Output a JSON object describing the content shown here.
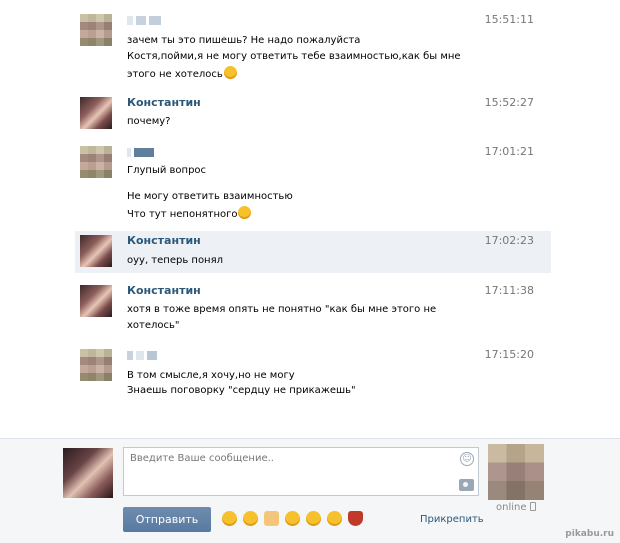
{
  "messages": [
    {
      "sender": "",
      "time": "15:51:11",
      "lines": [
        "зачем ты это пишешь? Не надо пожалуйста",
        "Костя,пойми,я не могу ответить тебе взаимностью,как бы мне",
        "этого не хотелось"
      ]
    },
    {
      "sender": "Константин",
      "time": "15:52:27",
      "lines": [
        "почему?"
      ]
    },
    {
      "sender": "",
      "time": "17:01:21",
      "lines": [
        "Глупый вопрос",
        "Не могу ответить взаимностью",
        "Что тут непонятного"
      ]
    },
    {
      "sender": "Константин",
      "time": "17:02:23",
      "lines": [
        "оуу, теперь понял"
      ]
    },
    {
      "sender": "Константин",
      "time": "17:11:38",
      "lines": [
        "хотя в тоже время опять не понятно \"как бы мне этого не",
        "хотелось\""
      ]
    },
    {
      "sender": "",
      "time": "17:15:20",
      "lines": [
        "В том смысле,я хочу,но не могу",
        "Знаешь поговорку \"сердцу не прикажешь\""
      ]
    }
  ],
  "composer": {
    "placeholder": "Введите Ваше сообщение..",
    "send_label": "Отправить",
    "attach_label": "Прикрепить",
    "online_label": "online"
  },
  "emoji_bar": [
    "crying-emoji",
    "tired-emoji",
    "thumbs-up-emoji",
    "sweat-smile-emoji",
    "smile-emoji",
    "wink-emoji",
    "broken-heart-emoji"
  ],
  "watermark": "pikabu.ru",
  "colors": {
    "name": "#2b587a",
    "time": "#777777",
    "highlight": "#edf1f5",
    "send": "#5e7fa6"
  }
}
